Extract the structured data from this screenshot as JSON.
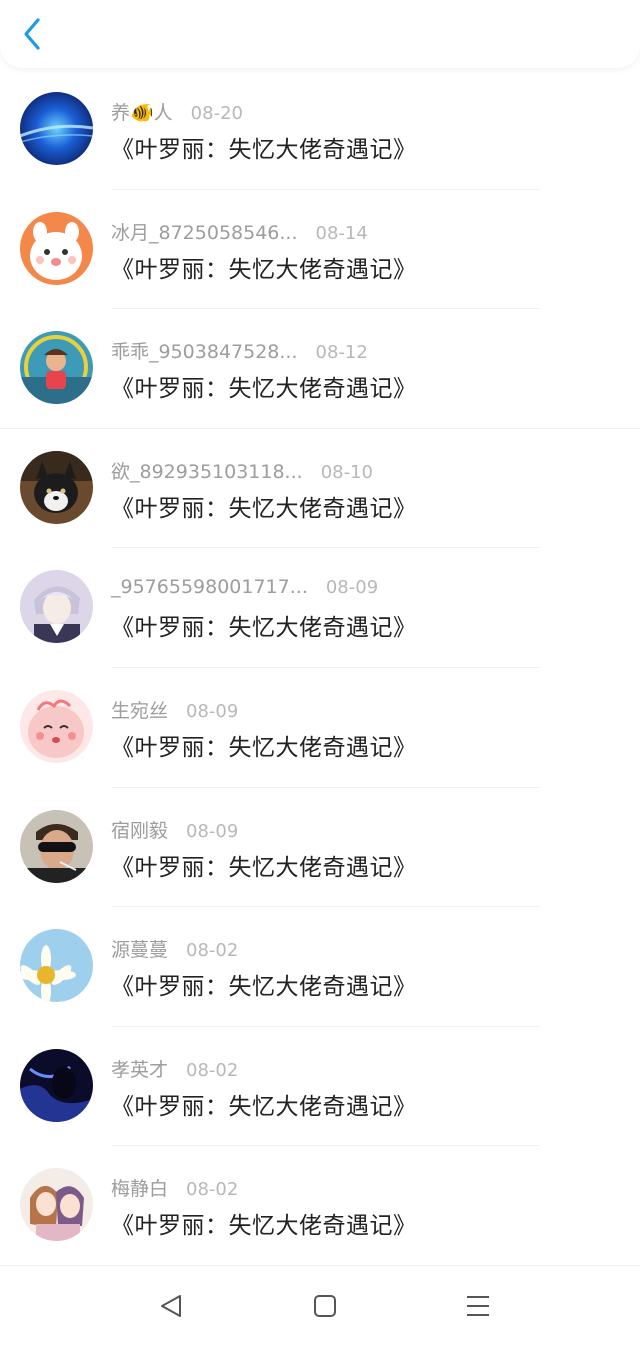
{
  "colors": {
    "accent": "#1a9be6",
    "name_text": "#9d9d9d",
    "date_text": "#b8b8b8",
    "title_text": "#222222"
  },
  "header": {
    "back_icon": "chevron-left-icon"
  },
  "items": [
    {
      "name": "养🐠人",
      "date": "08-20",
      "title": "《叶罗丽：失忆大佬奇遇记》"
    },
    {
      "name": "冰月_8725058546...",
      "date": "08-14",
      "title": "《叶罗丽：失忆大佬奇遇记》"
    },
    {
      "name": "乖乖_9503847528...",
      "date": "08-12",
      "title": "《叶罗丽：失忆大佬奇遇记》"
    },
    {
      "name": "欲_892935103118...",
      "date": "08-10",
      "title": "《叶罗丽：失忆大佬奇遇记》"
    },
    {
      "name": "_95765598001717...",
      "date": "08-09",
      "title": "《叶罗丽：失忆大佬奇遇记》"
    },
    {
      "name": "生宛丝",
      "date": "08-09",
      "title": "《叶罗丽：失忆大佬奇遇记》"
    },
    {
      "name": "宿刚毅",
      "date": "08-09",
      "title": "《叶罗丽：失忆大佬奇遇记》"
    },
    {
      "name": "源蔓蔓",
      "date": "08-02",
      "title": "《叶罗丽：失忆大佬奇遇记》"
    },
    {
      "name": "孝英才",
      "date": "08-02",
      "title": "《叶罗丽：失忆大佬奇遇记》"
    },
    {
      "name": "梅静白",
      "date": "08-02",
      "title": "《叶罗丽：失忆大佬奇遇记》"
    }
  ],
  "system_nav": {
    "back_icon": "triangle-back-icon",
    "home_icon": "square-home-icon",
    "menu_icon": "hamburger-menu-icon"
  }
}
